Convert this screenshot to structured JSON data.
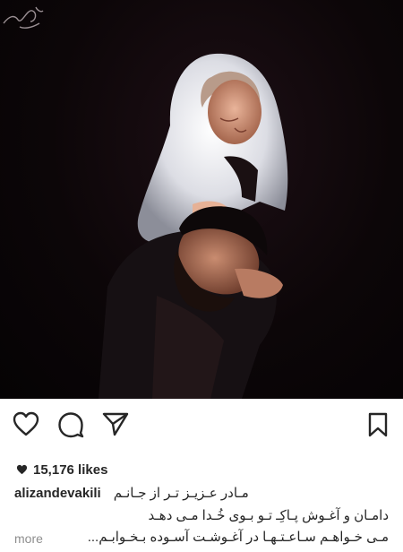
{
  "post": {
    "image_alt": "photo",
    "signature_text": "فیروز"
  },
  "actions": {
    "like": "heart-outline-icon",
    "comment": "speech-bubble-icon",
    "share": "paper-plane-icon",
    "save": "bookmark-icon"
  },
  "likes": {
    "count": "15,176 likes",
    "icon": "heart-filled-icon"
  },
  "caption": {
    "username": "alizandevakili",
    "line1": "مـادر عـزیـز تـر از جـانـم",
    "line2": "دامـان و آغـوش پـاکِـ تـو بـوی خُـدا مـی دهـد",
    "line3": "مـی خـواهـم سـاعـتـهـا در آغـوشـت آسـوده بـخـوابـم...",
    "more": "more"
  },
  "colors": {
    "text": "#262626",
    "muted": "#8e8e8e",
    "photo_bg": "#0c0608"
  }
}
